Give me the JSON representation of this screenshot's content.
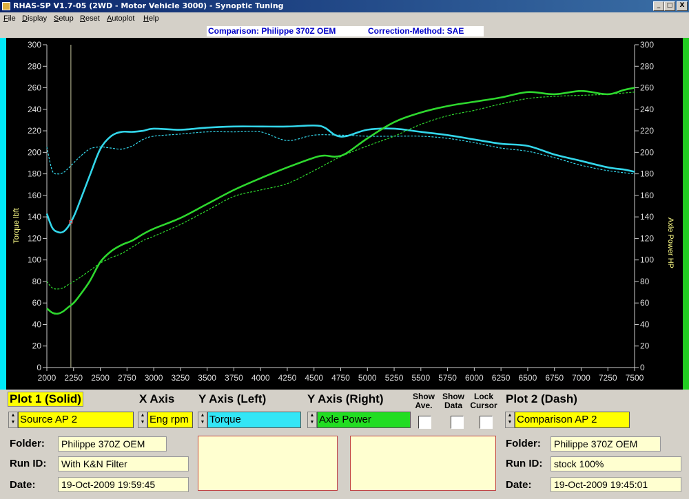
{
  "window": {
    "title": "RHAS-SP V1.7-05  (2WD - Motor Vehicle 3000) - Synoptic Tuning",
    "btn_min": "_",
    "btn_max": "□",
    "btn_close": "X"
  },
  "menu": [
    "File",
    "Display",
    "Setup",
    "Reset",
    "Autoplot",
    "Help"
  ],
  "heading": {
    "comparison": "Comparison: Philippe 370Z OEM",
    "method": "Correction-Method: SAE"
  },
  "colors": {
    "torque": "#33d6ea",
    "power": "#2ed82e",
    "axis_left": "#ffff88",
    "highlight": "#ffff00",
    "box_fill": "#ffffd0"
  },
  "chart_data": {
    "type": "line",
    "xlabel": "",
    "ylabel_left": "Torque lbft",
    "ylabel_right": "Axle Power HP",
    "xlim": [
      2000,
      7500
    ],
    "ylim_left": [
      0,
      300
    ],
    "ylim_right": [
      0,
      300
    ],
    "x_ticks": [
      2000,
      2250,
      2500,
      2750,
      3000,
      3250,
      3500,
      3750,
      4000,
      4250,
      4500,
      4750,
      5000,
      5250,
      5500,
      5750,
      6000,
      6250,
      6500,
      6750,
      7000,
      7250,
      7500
    ],
    "y_ticks": [
      0,
      20,
      40,
      60,
      80,
      100,
      120,
      140,
      160,
      180,
      200,
      220,
      240,
      260,
      280,
      300
    ],
    "cursor_x": 2225,
    "grid": false,
    "series": [
      {
        "name": "Torque",
        "style": "solid",
        "color": "#33d6ea",
        "x": [
          2000,
          2050,
          2100,
          2150,
          2200,
          2250,
          2300,
          2400,
          2500,
          2600,
          2700,
          2800,
          2900,
          3000,
          3250,
          3500,
          3750,
          4000,
          4250,
          4500,
          4600,
          4700,
          4800,
          5000,
          5250,
          5500,
          5750,
          6000,
          6250,
          6500,
          6750,
          7000,
          7250,
          7400,
          7500
        ],
        "y": [
          143,
          130,
          126,
          126,
          131,
          140,
          152,
          178,
          203,
          215,
          219,
          219,
          220,
          222,
          221,
          223,
          224,
          224,
          224,
          225,
          223,
          216,
          215,
          221,
          222,
          219,
          216,
          212,
          208,
          206,
          198,
          192,
          186,
          184,
          182
        ]
      },
      {
        "name": "Axle Power",
        "style": "solid",
        "color": "#2ed82e",
        "x": [
          2000,
          2050,
          2100,
          2150,
          2200,
          2250,
          2300,
          2400,
          2500,
          2600,
          2700,
          2800,
          2900,
          3000,
          3250,
          3500,
          3750,
          4000,
          4250,
          4500,
          4600,
          4700,
          4800,
          5000,
          5250,
          5500,
          5750,
          6000,
          6250,
          6500,
          6750,
          7000,
          7250,
          7400,
          7500
        ],
        "y": [
          55,
          51,
          50,
          52,
          56,
          60,
          66,
          80,
          98,
          108,
          114,
          118,
          124,
          129,
          139,
          152,
          165,
          176,
          186,
          195,
          197,
          196,
          199,
          213,
          228,
          237,
          243,
          247,
          251,
          256,
          254,
          257,
          254,
          258,
          260
        ]
      },
      {
        "name": "Torque (Comparison)",
        "style": "dash",
        "color": "#33d6ea",
        "x": [
          2000,
          2050,
          2100,
          2150,
          2200,
          2300,
          2400,
          2500,
          2600,
          2700,
          2800,
          2900,
          3000,
          3250,
          3500,
          3750,
          4000,
          4250,
          4500,
          4750,
          5000,
          5250,
          5500,
          5750,
          6000,
          6250,
          6500,
          6750,
          7000,
          7250,
          7500
        ],
        "y": [
          205,
          183,
          180,
          181,
          185,
          195,
          203,
          205,
          204,
          203,
          206,
          212,
          215,
          217,
          219,
          219,
          219,
          211,
          216,
          216,
          215,
          215,
          215,
          213,
          209,
          204,
          201,
          195,
          188,
          183,
          180
        ]
      },
      {
        "name": "Axle Power (Comparison)",
        "style": "dash",
        "color": "#2ed82e",
        "x": [
          2000,
          2050,
          2100,
          2150,
          2200,
          2300,
          2400,
          2500,
          2600,
          2700,
          2800,
          2900,
          3000,
          3250,
          3500,
          3750,
          4000,
          4250,
          4500,
          4750,
          5000,
          5250,
          5500,
          5750,
          6000,
          6250,
          6500,
          6750,
          7000,
          7250,
          7500
        ],
        "y": [
          80,
          74,
          73,
          74,
          77,
          83,
          90,
          97,
          102,
          106,
          112,
          118,
          122,
          133,
          146,
          159,
          165,
          171,
          183,
          196,
          206,
          215,
          226,
          234,
          239,
          245,
          250,
          252,
          253,
          254,
          256
        ]
      }
    ]
  },
  "panel": {
    "plot1_title": "Plot 1 (Solid)",
    "xaxis_title": "X Axis",
    "yleft_title": "Y Axis (Left)",
    "yright_title": "Y Axis (Right)",
    "show_ave_1": "Show",
    "show_ave_2": "Ave.",
    "show_data_1": "Show",
    "show_data_2": "Data",
    "lock_cursor_1": "Lock",
    "lock_cursor_2": "Cursor",
    "plot2_title": "Plot 2 (Dash)",
    "plot1_source": "Source AP 2",
    "xaxis_value": "Eng rpm",
    "yleft_value": "Torque",
    "yright_value": "Axle Power",
    "plot2_source": "Comparison AP 2",
    "folder_label": "Folder:",
    "runid_label": "Run ID:",
    "date_label": "Date:",
    "p1_folder": "Philippe 370Z OEM",
    "p1_runid": "With K&N  Filter",
    "p1_date": "19-Oct-2009  19:59:45",
    "p2_folder": "Philippe 370Z OEM",
    "p2_runid": "stock 100%",
    "p2_date": "19-Oct-2009  19:45:01"
  }
}
